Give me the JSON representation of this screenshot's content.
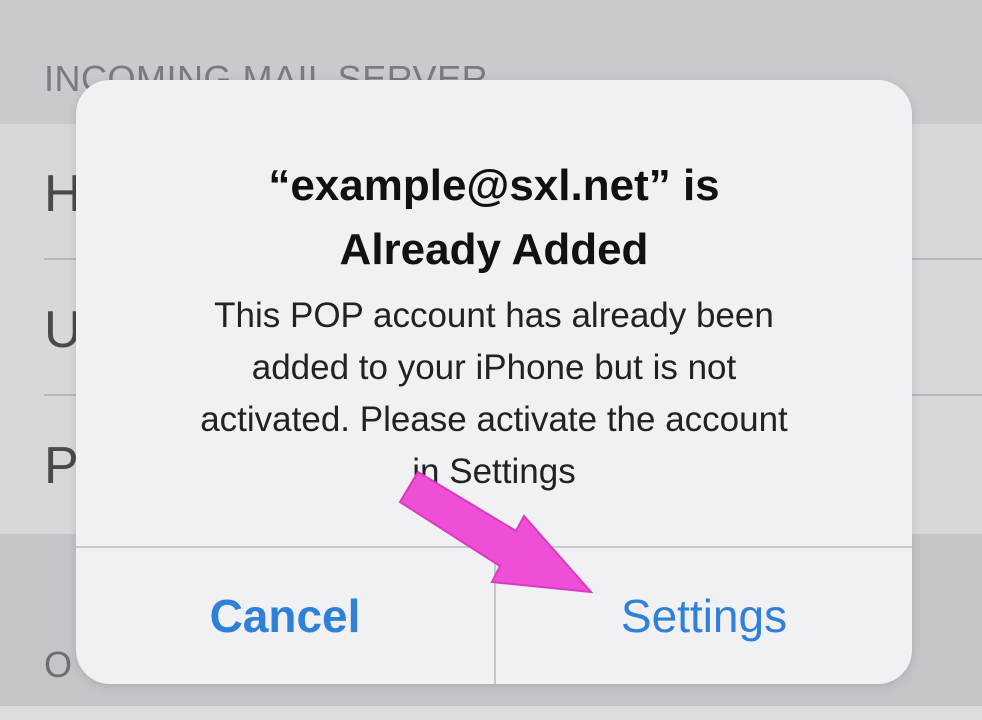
{
  "background": {
    "section_header": "INCOMING MAIL SERVER",
    "rows": [
      {
        "label": "H"
      },
      {
        "label": "U"
      },
      {
        "label": "P"
      }
    ],
    "footer_label": "O"
  },
  "alert": {
    "title_line1": "“example@sxl.net” is",
    "title_line2": "Already Added",
    "message_lines": [
      "This POP account has already been",
      "added to your iPhone but is not",
      "activated. Please activate the account",
      "in Settings"
    ],
    "cancel_label": "Cancel",
    "settings_label": "Settings"
  },
  "annotation": {
    "arrow_color": "#ee4fd6",
    "arrow_target": "settings-button"
  },
  "colors": {
    "accent": "#2f80d9",
    "alert_background": "#f1f1f3"
  }
}
